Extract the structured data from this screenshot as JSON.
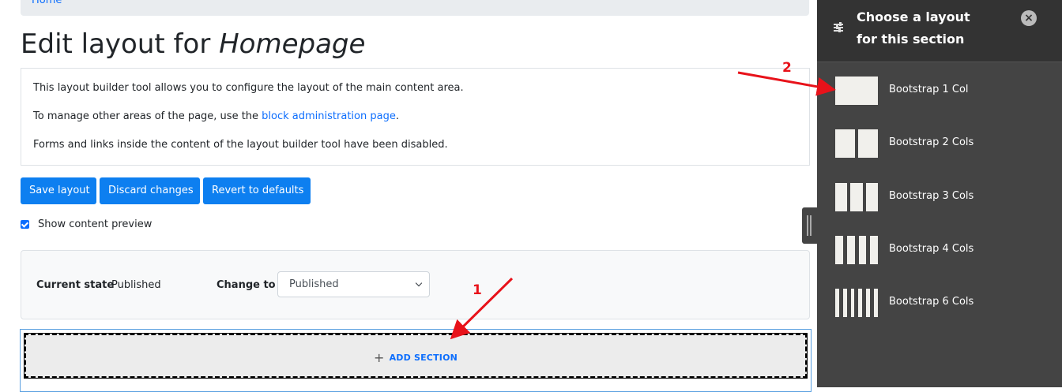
{
  "breadcrumb": {
    "home": "Home"
  },
  "page": {
    "title_prefix": "Edit layout for ",
    "title_node": "Homepage"
  },
  "help": {
    "line1": "This layout builder tool allows you to configure the layout of the main content area.",
    "line2_prefix": "To manage other areas of the page, use the ",
    "line2_link": "block administration page",
    "line2_suffix": ".",
    "line3": "Forms and links inside the content of the layout builder tool have been disabled."
  },
  "actions": {
    "save": "Save layout",
    "discard": "Discard changes",
    "revert": "Revert to defaults"
  },
  "preview": {
    "label": "Show content preview",
    "checked": true
  },
  "moderation": {
    "current_label": "Current state",
    "current_value": "Published",
    "change_label": "Change to",
    "change_value": "Published"
  },
  "add_section": {
    "label": "ADD SECTION",
    "plus": "+"
  },
  "sidebar": {
    "title": "Choose a layout for this section",
    "close": "×",
    "layouts": [
      {
        "label": "Bootstrap 1 Col",
        "cols": 1
      },
      {
        "label": "Bootstrap 2 Cols",
        "cols": 2
      },
      {
        "label": "Bootstrap 3 Cols",
        "cols": 3
      },
      {
        "label": "Bootstrap 4 Cols",
        "cols": 4
      },
      {
        "label": "Bootstrap 6 Cols",
        "cols": 6
      }
    ]
  },
  "annotations": {
    "one": "1",
    "two": "2",
    "color": "#e8121a"
  },
  "colors": {
    "button": "#0d7ff0",
    "sidebar_bg": "#444444",
    "sidebar_header": "#333333",
    "link": "#0d6efd"
  }
}
